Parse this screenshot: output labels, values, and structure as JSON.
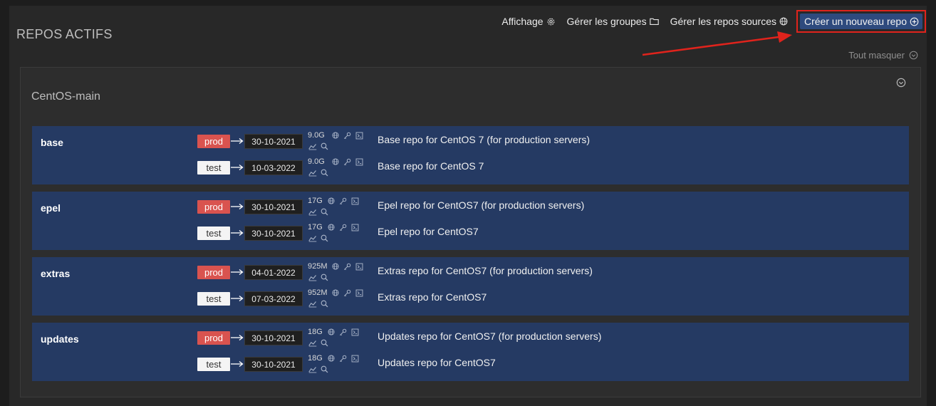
{
  "page_title": "REPOS ACTIFS",
  "toolbar": {
    "display_label": "Affichage",
    "groups_label": "Gérer les groupes",
    "sources_label": "Gérer les repos sources",
    "create_label": "Créer un nouveau repo"
  },
  "hide_all_label": "Tout masquer",
  "group": {
    "name": "CentOS-main",
    "repos": [
      {
        "name": "base",
        "envs": [
          {
            "env": "prod",
            "date": "30-10-2021",
            "size": "9.0G",
            "description": "Base repo for CentOS 7 (for production servers)"
          },
          {
            "env": "test",
            "date": "10-03-2022",
            "size": "9.0G",
            "description": "Base repo for CentOS 7"
          }
        ]
      },
      {
        "name": "epel",
        "envs": [
          {
            "env": "prod",
            "date": "30-10-2021",
            "size": "17G",
            "description": "Epel repo for CentOS7 (for production servers)"
          },
          {
            "env": "test",
            "date": "30-10-2021",
            "size": "17G",
            "description": "Epel repo for CentOS7"
          }
        ]
      },
      {
        "name": "extras",
        "envs": [
          {
            "env": "prod",
            "date": "04-01-2022",
            "size": "925M",
            "description": "Extras repo for CentOS7 (for production servers)"
          },
          {
            "env": "test",
            "date": "07-03-2022",
            "size": "952M",
            "description": "Extras repo for CentOS7"
          }
        ]
      },
      {
        "name": "updates",
        "envs": [
          {
            "env": "prod",
            "date": "30-10-2021",
            "size": "18G",
            "description": "Updates repo for CentOS7 (for production servers)"
          },
          {
            "env": "test",
            "date": "30-10-2021",
            "size": "18G",
            "description": "Updates repo for CentOS7"
          }
        ]
      }
    ]
  },
  "colors": {
    "prod_badge": "#d9534f",
    "test_badge": "#f4f4f4",
    "repo_background": "#253a63",
    "create_button": "#2e4a7e",
    "highlight": "#e0231c"
  },
  "icons": [
    "gear-icon",
    "folder-icon",
    "globe-icon",
    "plus-circle-icon",
    "chevron-down-icon",
    "key-icon",
    "terminal-icon",
    "chart-icon",
    "search-icon"
  ]
}
